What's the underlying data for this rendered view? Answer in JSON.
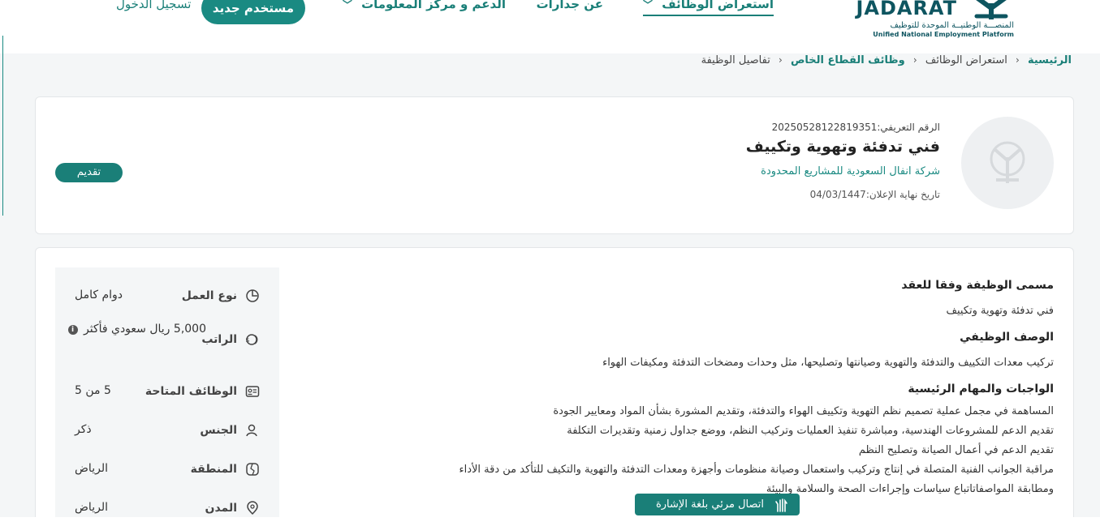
{
  "header": {
    "logo_word": "JADARAT",
    "logo_ar": "المنصـــة الوطنيــة الموحدة للتوظيف",
    "logo_en": "Unified National Employment Platform",
    "nav": {
      "browse_jobs": "استعراض الوظائف",
      "about": "عن جدارات",
      "support": "الدعم و مركز المعلومات"
    },
    "register_label": "مستخدم جديد",
    "login_label": "تسجيل الدخول"
  },
  "breadcrumb": {
    "home": "الرئيسية",
    "browse": "استعراض الوظائف",
    "private_sector": "وظائف القطاع الخاص",
    "current": "تفاصيل الوظيفة",
    "separator": "‹"
  },
  "job": {
    "id_label": "الرقم التعريفي:",
    "id_value": "20250528122819351",
    "title": "فني تدفئة وتهوية وتكييف",
    "company": "شركة انفال السعودية للمشاريع المحدودة",
    "deadline_label": "تاريخ نهاية الإعلان:",
    "deadline_value": "04/03/1447",
    "apply_label": "تقديم"
  },
  "details": {
    "contract_title_heading": "مسمى الوظيفة وفقا للعقد",
    "contract_title_value": "فني تدفئة وتهوية وتكييف",
    "description_heading": "الوصف الوظيفي",
    "description_value": "تركيب معدات التكييف والتدفئة والتهوية وصيانتها وتصليحها، مثل وحدات ومضخات التدفئة ومكيفات الهواء",
    "duties_heading": "الواجبات والمهام الرئيسية",
    "duties": [
      "المساهمة في مجمل عملية تصميم نظم التهوية وتكييف الهواء والتدفئة، وتقديم المشورة بشأن المواد ومعايير الجودة",
      "تقديم الدعم للمشروعات الهندسية، ومباشرة تنفيذ العمليات وتركيب النظم، ووضع جداول زمنية وتقديرات التكلفة",
      "تقديم الدعم في أعمال الصيانة وتصليح النظم",
      "مراقبة الجوانب الفنية المتصلة في إنتاج وتركيب واستعمال وصيانة منظومات وأجهزة ومعدات التدفئة والتهوية  والتكيف  للتأكد من دقة الأداء",
      "ومطابقة المواصفاتاتباع سياسات وإجراءات الصحة والسلامة والبيئة"
    ]
  },
  "sidebar": {
    "work_type_label": "نوع العمل",
    "work_type_value": "دوام كامل",
    "salary_label": "الراتب",
    "salary_value": "5,000 ريال سعودي فأكثر",
    "vacancies_label": "الوظائف المتاحة",
    "vacancies_value": "5 من 5",
    "gender_label": "الجنس",
    "gender_value": "ذكر",
    "region_label": "المنطقة",
    "region_value": "الرياض",
    "city_label": "المدن",
    "city_value": "الرياض"
  },
  "sign_language": {
    "label": "اتصال مرئي بلغة الإشارة"
  },
  "colors": {
    "accent": "#1a7f78",
    "brand_dark": "#0e5560"
  }
}
